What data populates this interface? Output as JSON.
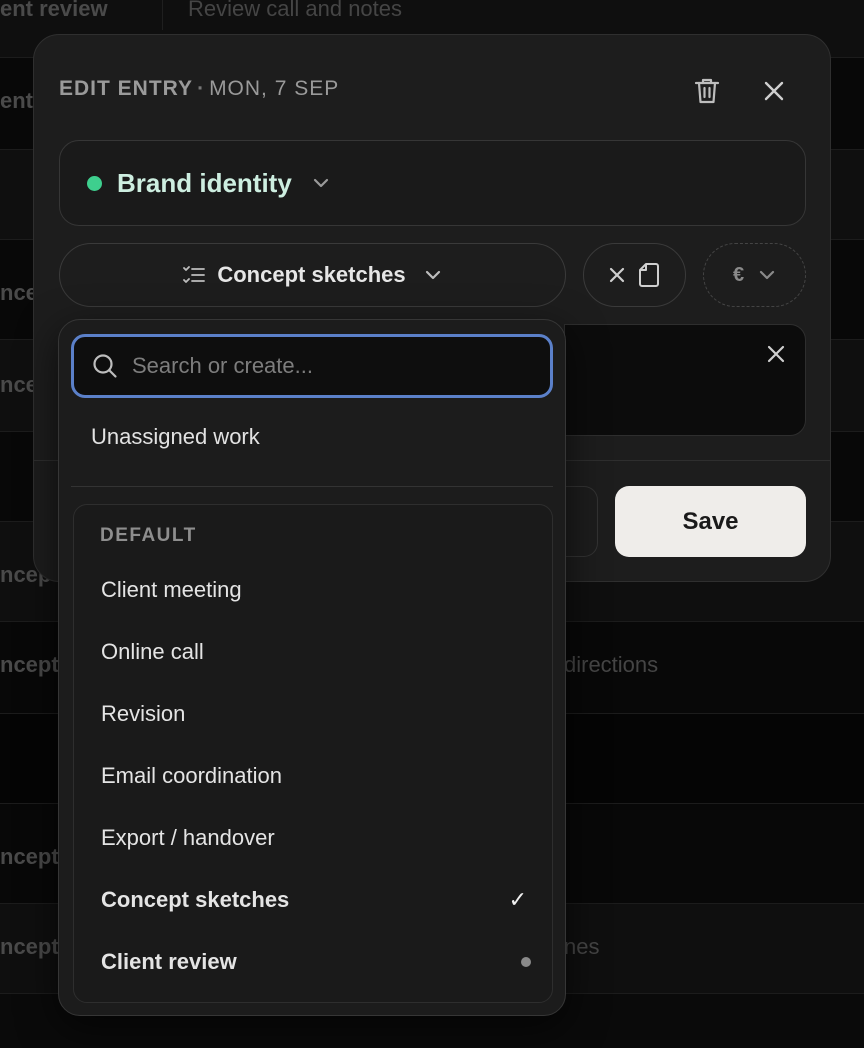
{
  "background": {
    "rows": [
      {
        "task": "ent review",
        "note": "Review call and notes"
      },
      {
        "task": "ent",
        "note": ""
      },
      {
        "task": "",
        "note": ""
      },
      {
        "task": "nce",
        "note": ""
      },
      {
        "task": "nce",
        "note": ""
      },
      {
        "task": "",
        "note": ""
      },
      {
        "task": "ncep",
        "note": ""
      },
      {
        "task": "ncept",
        "note": "directions"
      },
      {
        "task": "",
        "note": ""
      },
      {
        "task": "ncept",
        "note": ""
      },
      {
        "task": "ncept",
        "note": "nes"
      }
    ]
  },
  "modal": {
    "title": "EDIT ENTRY",
    "separator": "·",
    "date": "MON, 7 SEP",
    "project": {
      "name": "Brand identity",
      "color": "#3ecf8e"
    },
    "task": {
      "label": "Concept sketches"
    },
    "currency": {
      "symbol": "€"
    },
    "save_label": "Save"
  },
  "dropdown": {
    "search_placeholder": "Search or create...",
    "unassigned_label": "Unassigned work",
    "group_title": "DEFAULT",
    "items": [
      {
        "label": "Client meeting",
        "state": "none"
      },
      {
        "label": "Online call",
        "state": "none"
      },
      {
        "label": "Revision",
        "state": "none"
      },
      {
        "label": "Email coordination",
        "state": "none"
      },
      {
        "label": "Export / handover",
        "state": "none"
      },
      {
        "label": "Concept sketches",
        "state": "selected",
        "mark": "✓"
      },
      {
        "label": "Client review",
        "state": "current"
      }
    ]
  },
  "colors": {
    "accent_focus": "#5b80c9",
    "project_dot": "#3ecf8e",
    "save_bg": "#efedea"
  }
}
